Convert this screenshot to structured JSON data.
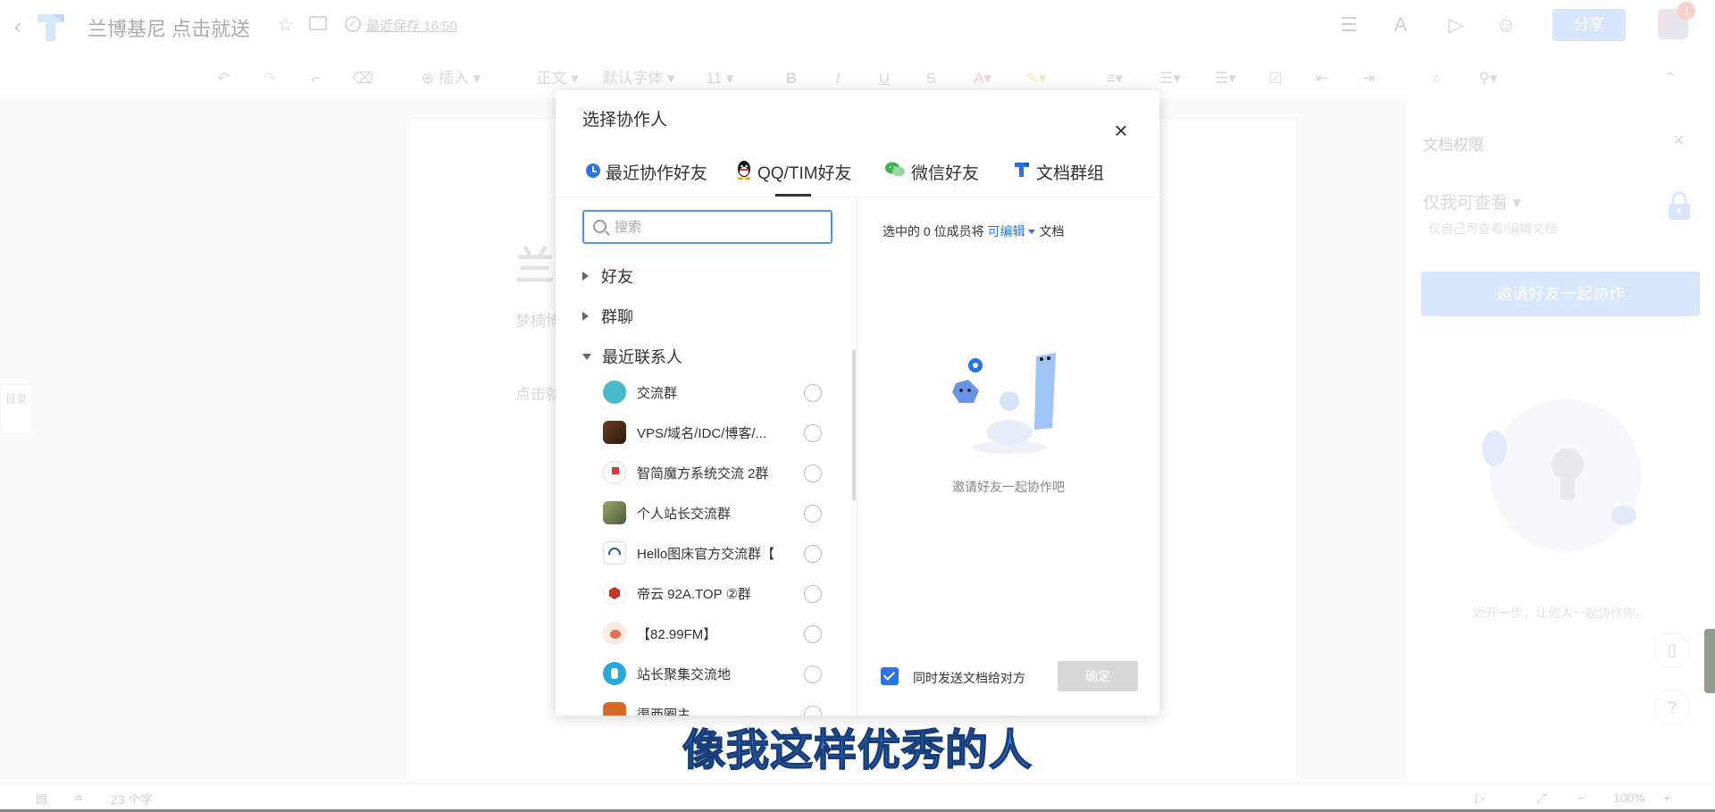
{
  "topbar": {
    "title": "兰博基尼 点击就送",
    "save_status": "最近保存 16:50",
    "share_label": "分享",
    "notification_count": "1"
  },
  "toolbar": {
    "insert_label": "插入",
    "style_label": "正文",
    "font_label": "默认字体",
    "size_label": "11"
  },
  "document": {
    "heading": "兰",
    "author": "梦楠博",
    "hint": "点击就"
  },
  "toc_label": "目录",
  "right_panel": {
    "title": "文档权限",
    "permission": "仅我可查看",
    "permission_desc": "仅自己可查看/编辑文档",
    "invite_button": "邀请好友一起协作",
    "tip": "近开一步，让他人一起协作你。"
  },
  "statusbar": {
    "word_count": "23 个字",
    "zoom": "100%"
  },
  "subtitle": "像我这样优秀的人",
  "dialog": {
    "title": "选择协作人",
    "tabs": [
      {
        "label": "最近协作好友",
        "icon": "clock-icon"
      },
      {
        "label": "QQ/TIM好友",
        "icon": "qq-penguin-icon"
      },
      {
        "label": "微信好友",
        "icon": "wechat-icon"
      },
      {
        "label": "文档群组",
        "icon": "docs-logo-icon"
      }
    ],
    "active_tab": "QQ/TIM好友",
    "search_placeholder": "搜索",
    "groups": [
      {
        "label": "好友",
        "expanded": false
      },
      {
        "label": "群聊",
        "expanded": false
      },
      {
        "label": "最近联系人",
        "expanded": true
      }
    ],
    "contacts": [
      {
        "name": "交流群",
        "color": "#4ab9c9"
      },
      {
        "name": "VPS/域名/IDC/博客/...",
        "color": "#4a2e1e"
      },
      {
        "name": "智简魔方系统交流 2群",
        "color": "#d73a3a"
      },
      {
        "name": "个人站长交流群",
        "color": "#7a8a5a"
      },
      {
        "name": "Hello图床官方交流群【",
        "color": "#2d5aa5"
      },
      {
        "name": "帝云 92A.TOP ②群",
        "color": "#c0392b"
      },
      {
        "name": "【82.99FM】",
        "color": "#e07050"
      },
      {
        "name": "站长聚集交流地",
        "color": "#2aa6d9"
      },
      {
        "name": "渠西圈主",
        "color": "#d56a2a"
      }
    ],
    "selection_prefix": "选中的 0 位成员将",
    "permission_link": "可编辑",
    "selection_suffix": "文档",
    "empty_tip": "邀请好友一起协作吧",
    "send_label": "同时发送文档给对方",
    "send_checked": true,
    "confirm_label": "确定",
    "accent": "#2a72e5"
  }
}
